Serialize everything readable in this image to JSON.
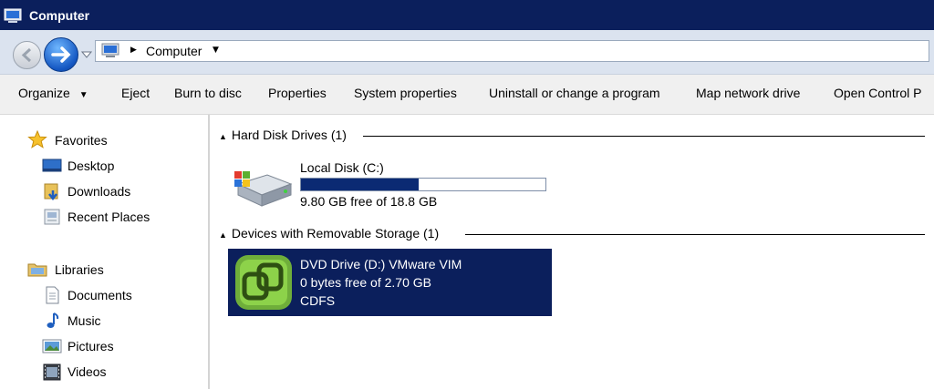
{
  "window": {
    "title": "Computer"
  },
  "address": {
    "location": "Computer"
  },
  "toolbar": {
    "organize": "Organize",
    "eject": "Eject",
    "burn": "Burn to disc",
    "properties": "Properties",
    "system_properties": "System properties",
    "uninstall": "Uninstall or change a program",
    "map_drive": "Map network drive",
    "control_panel": "Open Control P"
  },
  "nav": {
    "favorites": "Favorites",
    "desktop": "Desktop",
    "downloads": "Downloads",
    "recent": "Recent Places",
    "libraries": "Libraries",
    "documents": "Documents",
    "music": "Music",
    "pictures": "Pictures",
    "videos": "Videos"
  },
  "groups": {
    "hdd": "Hard Disk Drives (1)",
    "removable": "Devices with Removable Storage (1)"
  },
  "drives": {
    "c": {
      "name": "Local Disk (C:)",
      "free": "9.80 GB free of 18.8 GB",
      "used_fraction": 0.48
    },
    "d": {
      "name": "DVD Drive (D:) VMware VIM",
      "free": "0 bytes free of 2.70 GB",
      "fs": "CDFS"
    }
  },
  "colors": {
    "title_bar": "#0b1f5c",
    "selection": "#0b1f5c",
    "usage_bar": "#0b2a73",
    "vmware_green": "#7cc242"
  }
}
